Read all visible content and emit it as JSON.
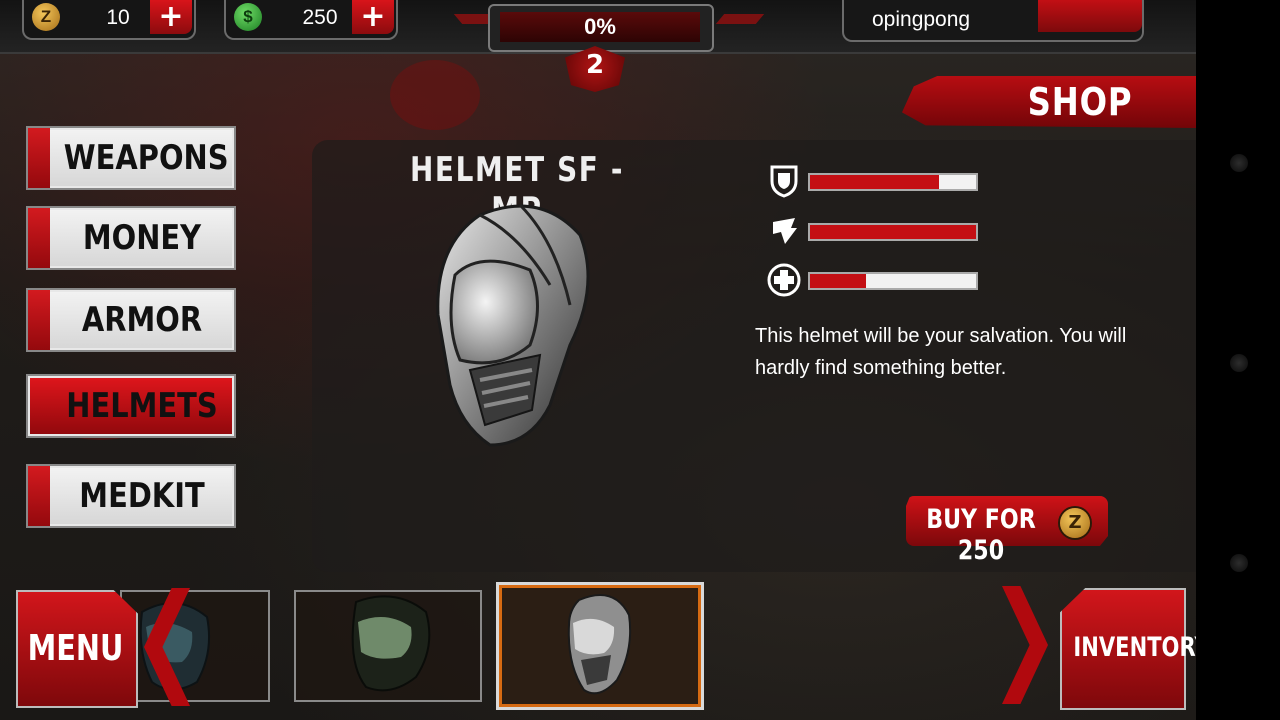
{
  "currency": {
    "z_coins": "10",
    "z_icon": "z-coin-icon",
    "cash": "250",
    "cash_icon": "dollar-coin-icon",
    "add_label": "+"
  },
  "xp": {
    "percent_text": "0%",
    "progress": 0.0,
    "level": "2"
  },
  "user": {
    "name": "opingpong"
  },
  "shop": {
    "title": "SHOP"
  },
  "categories": [
    {
      "label": "WEAPONS",
      "active": false
    },
    {
      "label": "MONEY",
      "active": false
    },
    {
      "label": "ARMOR",
      "active": false
    },
    {
      "label": "HELMETS",
      "active": true
    },
    {
      "label": "MEDKIT",
      "active": false
    }
  ],
  "item": {
    "name": "HELMET SF - MP",
    "stats": [
      {
        "icon": "shield-icon",
        "value": 0.78
      },
      {
        "icon": "claw-icon",
        "value": 1.0
      },
      {
        "icon": "health-cross-icon",
        "value": 0.34
      }
    ],
    "description": "This helmet will be your salvation. You will hardly find something better.",
    "buy_label": "BUY FOR 250"
  },
  "bottom": {
    "menu_label": "MENU",
    "inventory_label": "INVENTORY"
  },
  "colors": {
    "accent_red": "#c40f14",
    "selected_slot_glow": "#d66a12"
  }
}
